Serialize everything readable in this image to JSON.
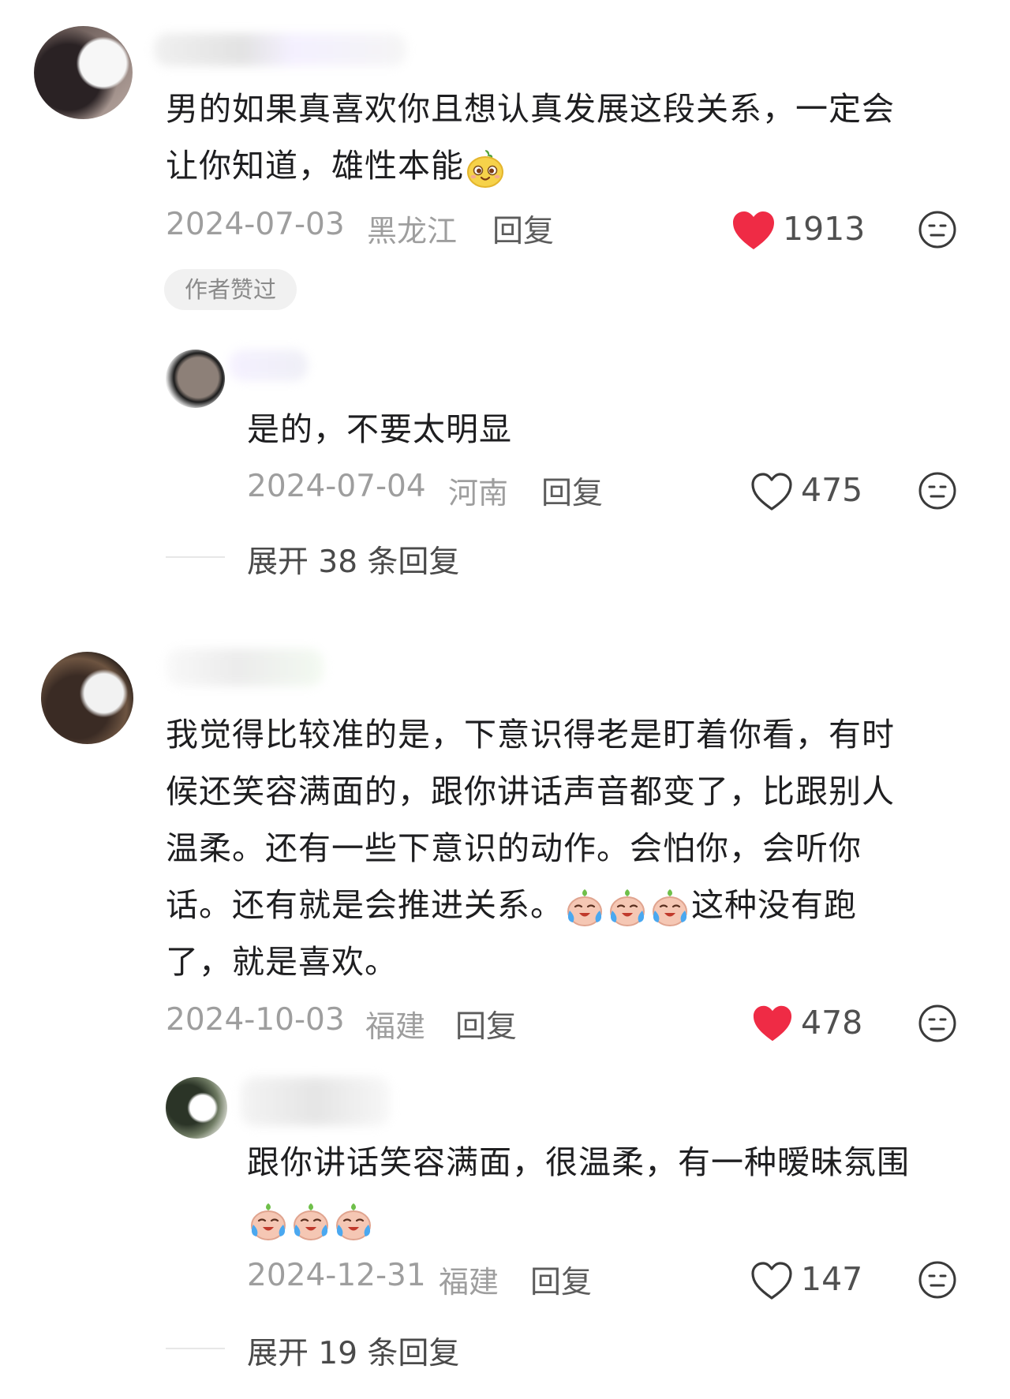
{
  "comments": [
    {
      "body": "男的如果真喜欢你且想认真发展这段关系，一定会让你知道，雄性本能",
      "line1": "男的如果真喜欢你且想认真发展这段关系，一定会",
      "line2": "让你知道，雄性本能",
      "date": "2024-07-03",
      "location": "黑龙江",
      "reply_label": "回复",
      "likes": "1913",
      "liked": true,
      "badge": "作者赞过",
      "emoji": "yellow-face-emoji"
    },
    {
      "body": "是的，不要太明显",
      "date": "2024-07-04",
      "location": "河南",
      "reply_label": "回复",
      "likes": "475",
      "liked": false,
      "expand": "展开 38 条回复"
    },
    {
      "line1": "我觉得比较准的是，下意识得老是盯着你看，有时",
      "line2": "候还笑容满面的，跟你讲话声音都变了，比跟别人",
      "line3": "温柔。还有一些下意识的动作。会怕你，会听你",
      "line4a": "话。还有就是会推进关系。",
      "line4b": "这种没有跑",
      "line5": "了，就是喜欢。",
      "date": "2024-10-03",
      "location": "福建",
      "reply_label": "回复",
      "likes": "478",
      "liked": true,
      "emoji": "crying-face-emoji"
    },
    {
      "line1": "跟你讲话笑容满面，很温柔，有一种暧昧氛围",
      "date": "2024-12-31",
      "location": "福建",
      "reply_label": "回复",
      "likes": "147",
      "liked": false,
      "expand": "展开 19 条回复",
      "emoji": "crying-face-emoji"
    }
  ],
  "colors": {
    "heart_red": "#ef2b45",
    "text": "#1e1e20",
    "meta": "#9e9e9e"
  }
}
